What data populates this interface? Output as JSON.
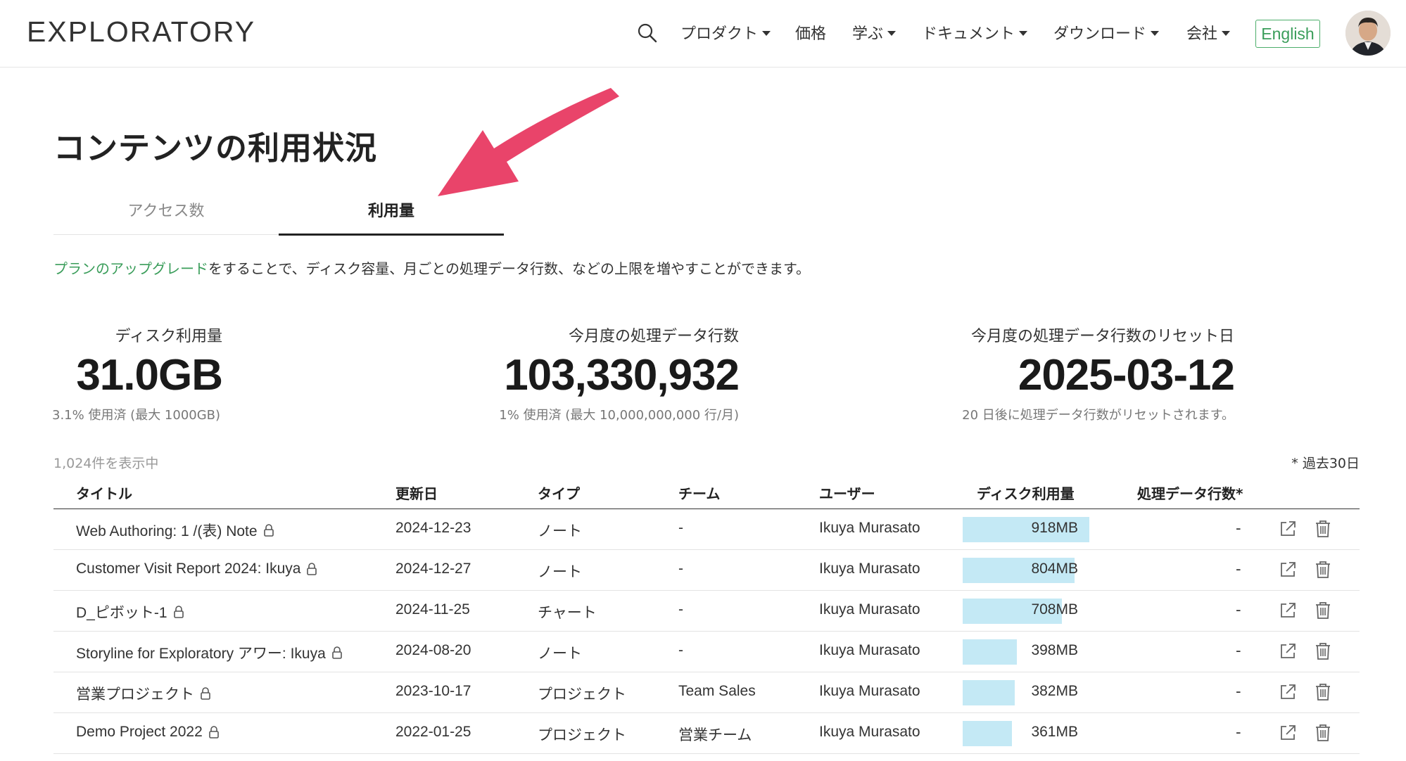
{
  "header": {
    "logo": "EXPLORATORY",
    "nav": [
      {
        "label": "プロダクト",
        "dropdown": true
      },
      {
        "label": "価格",
        "dropdown": false
      },
      {
        "label": "学ぶ",
        "dropdown": true
      },
      {
        "label": "ドキュメント",
        "dropdown": true
      },
      {
        "label": "ダウンロード",
        "dropdown": true
      },
      {
        "label": "会社",
        "dropdown": true
      }
    ],
    "lang_button": "English"
  },
  "page": {
    "title": "コンテンツの利用状況"
  },
  "tabs": {
    "access": "アクセス数",
    "usage": "利用量",
    "active": "usage"
  },
  "info": {
    "link": "プランのアップグレード",
    "rest": "をすることで、ディスク容量、月ごとの処理データ行数、などの上限を増やすことができます。"
  },
  "stats": {
    "disk": {
      "label": "ディスク利用量",
      "value": "31.0GB",
      "sub": "3.1% 使用済 (最大 1000GB)"
    },
    "rows": {
      "label": "今月度の処理データ行数",
      "value": "103,330,932",
      "sub": "1% 使用済 (最大 10,000,000,000 行/月)"
    },
    "reset": {
      "label": "今月度の処理データ行数のリセット日",
      "value": "2025-03-12",
      "sub": "20 日後に処理データ行数がリセットされます。"
    }
  },
  "table": {
    "count": "1,024件を表示中",
    "period": "* 過去30日",
    "headers": {
      "title": "タイトル",
      "updated": "更新日",
      "type": "タイプ",
      "team": "チーム",
      "user": "ユーザー",
      "disk": "ディスク利用量",
      "rows": "処理データ行数*"
    },
    "rows": [
      {
        "title": "Web Authoring: 1 /(表) Note",
        "updated": "2024-12-23",
        "type": "ノート",
        "team": "-",
        "user": "Ikuya Murasato",
        "disk": "918MB",
        "disk_mb": 918,
        "rows": "-"
      },
      {
        "title": "Customer Visit Report 2024: Ikuya",
        "updated": "2024-12-27",
        "type": "ノート",
        "team": "-",
        "user": "Ikuya Murasato",
        "disk": "804MB",
        "disk_mb": 804,
        "rows": "-"
      },
      {
        "title": "D_ピボット-1",
        "updated": "2024-11-25",
        "type": "チャート",
        "team": "-",
        "user": "Ikuya Murasato",
        "disk": "708MB",
        "disk_mb": 708,
        "rows": "-"
      },
      {
        "title": "Storyline for Exploratory アワー: Ikuya",
        "updated": "2024-08-20",
        "type": "ノート",
        "team": "-",
        "user": "Ikuya Murasato",
        "disk": "398MB",
        "disk_mb": 398,
        "rows": "-"
      },
      {
        "title": "営業プロジェクト",
        "updated": "2023-10-17",
        "type": "プロジェクト",
        "team": "Team Sales",
        "user": "Ikuya Murasato",
        "disk": "382MB",
        "disk_mb": 382,
        "rows": "-"
      },
      {
        "title": "Demo Project 2022",
        "updated": "2022-01-25",
        "type": "プロジェクト",
        "team": "営業チーム",
        "user": "Ikuya Murasato",
        "disk": "361MB",
        "disk_mb": 361,
        "rows": "-"
      }
    ]
  },
  "colors": {
    "accent_green": "#3a9d5a",
    "bar_fill": "#c4e9f5",
    "arrow": "#e9446a"
  }
}
